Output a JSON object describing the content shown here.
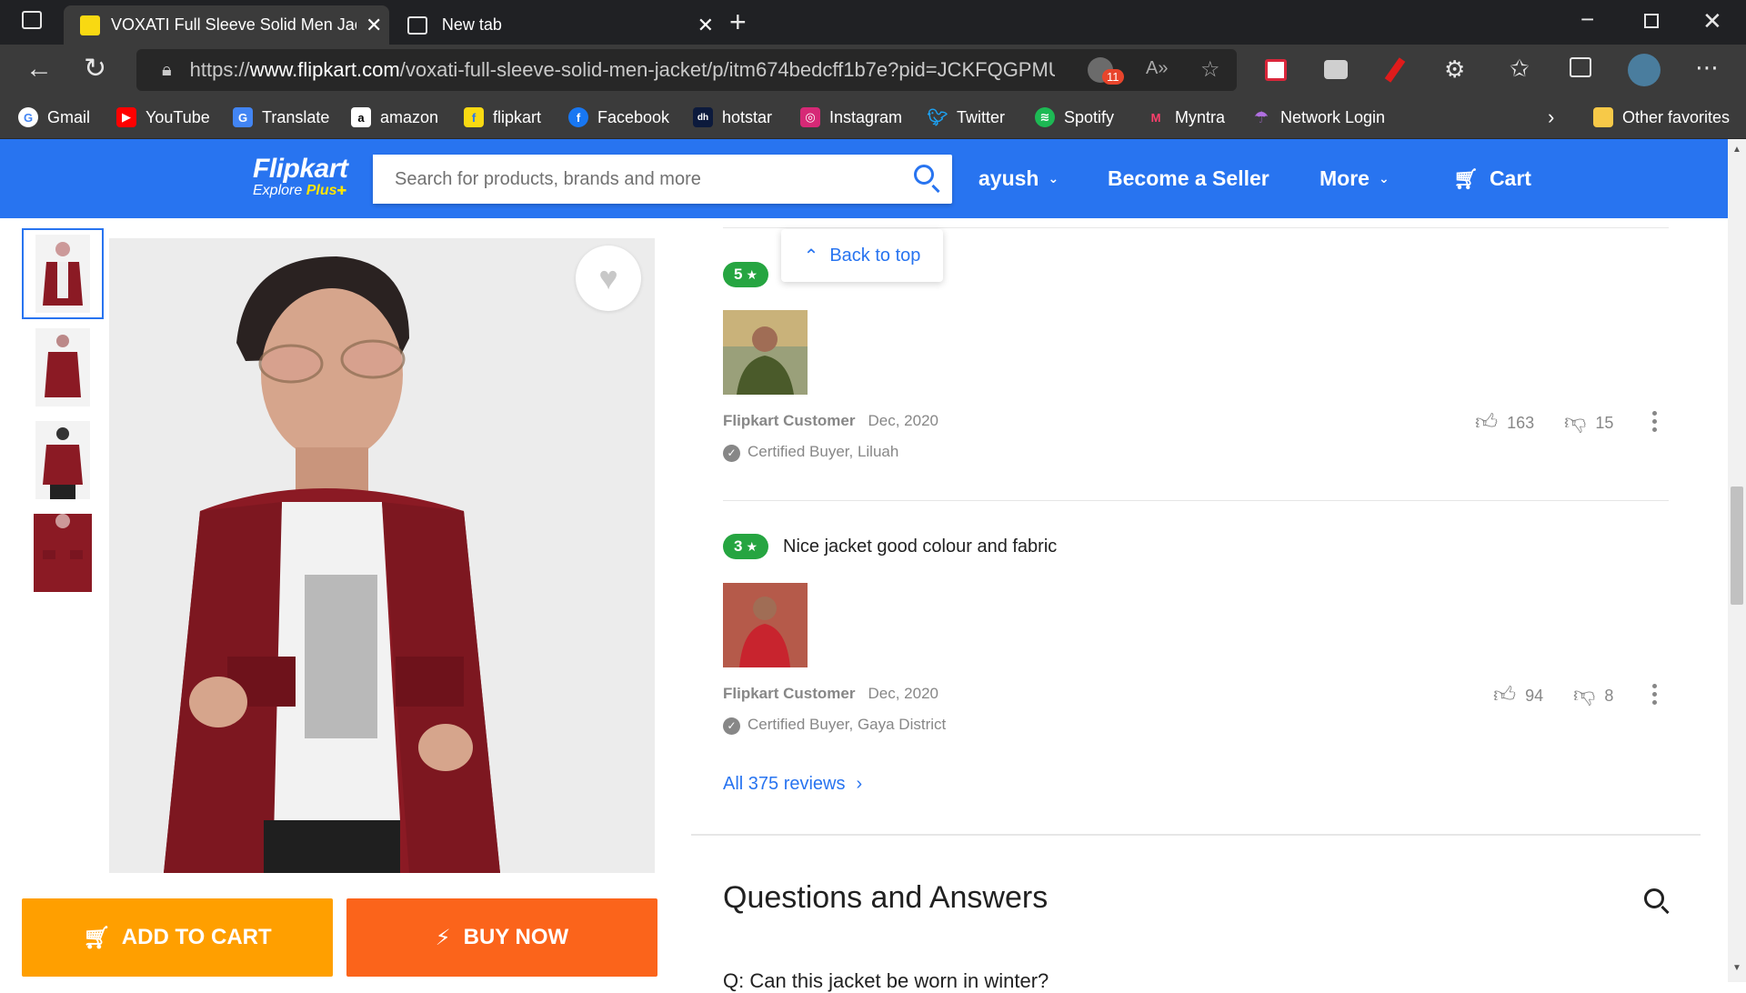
{
  "browser": {
    "tabs": [
      {
        "title": "VOXATI Full Sleeve Solid Men Jac",
        "active": true
      },
      {
        "title": "New tab",
        "active": false
      }
    ],
    "url_prefix": "https://",
    "url_host": "www.flipkart.com",
    "url_path": "/voxati-full-sleeve-solid-men-jacket/p/itm674bedcff1b7e?pid=JCKFQGPMU...",
    "notification_count": "11",
    "bookmarks": [
      "Gmail",
      "YouTube",
      "Translate",
      "amazon",
      "flipkart",
      "Facebook",
      "hotstar",
      "Instagram",
      "Twitter",
      "Spotify",
      "Myntra",
      "Network Login"
    ],
    "other_favorites": "Other favorites"
  },
  "header": {
    "logo": "Flipkart",
    "logo_sub": "Explore",
    "logo_plus": "Plus",
    "search_placeholder": "Search for products, brands and more",
    "user": "ayush",
    "seller": "Become a Seller",
    "more": "More",
    "cart": "Cart",
    "brand_color": "#2874f0"
  },
  "product": {
    "add_to_cart": "ADD TO CART",
    "buy_now": "BUY NOW",
    "jacket_color": "#8b1a24"
  },
  "back_to_top": "Back to top",
  "reviews": [
    {
      "rating": "5",
      "title": "",
      "author": "Flipkart Customer",
      "date": "Dec, 2020",
      "certified": "Certified Buyer, Liluah",
      "likes": "163",
      "dislikes": "15"
    },
    {
      "rating": "3",
      "title": "Nice jacket good colour and fabric",
      "author": "Flipkart Customer",
      "date": "Dec, 2020",
      "certified": "Certified Buyer, Gaya District",
      "likes": "94",
      "dislikes": "8"
    }
  ],
  "all_reviews": "All 375 reviews",
  "qa": {
    "title": "Questions and Answers",
    "first_question": "Q: Can this jacket be worn in winter?"
  }
}
